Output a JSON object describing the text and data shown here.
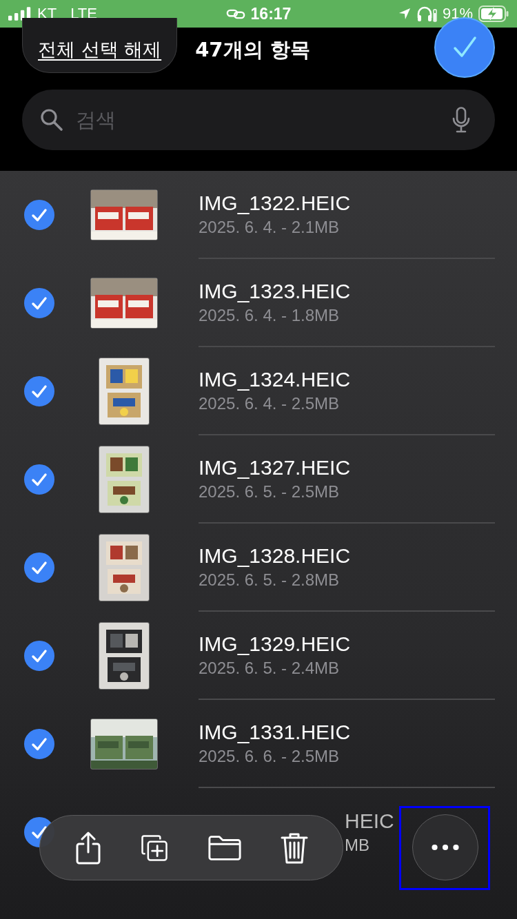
{
  "status_bar": {
    "carrier": "KT",
    "network": "LTE",
    "time": "16:17",
    "battery": "91%"
  },
  "header": {
    "deselect_button": "전체 선택 해제",
    "count": "47개의 항목",
    "done_selected": true
  },
  "search": {
    "placeholder": "검색"
  },
  "files": [
    {
      "name": "IMG_1322.HEIC",
      "meta": "2025. 6. 4. - 2.1MB",
      "checked": true,
      "partial": false
    },
    {
      "name": "IMG_1323.HEIC",
      "meta": "2025. 6. 4. - 1.8MB",
      "checked": true,
      "partial": false
    },
    {
      "name": "IMG_1324.HEIC",
      "meta": "2025. 6. 4. - 2.5MB",
      "checked": true,
      "partial": false
    },
    {
      "name": "IMG_1327.HEIC",
      "meta": "2025. 6. 5. - 2.5MB",
      "checked": true,
      "partial": false
    },
    {
      "name": "IMG_1328.HEIC",
      "meta": "2025. 6. 5. - 2.8MB",
      "checked": true,
      "partial": false
    },
    {
      "name": "IMG_1329.HEIC",
      "meta": "2025. 6. 5. - 2.4MB",
      "checked": true,
      "partial": false
    },
    {
      "name": "IMG_1331.HEIC",
      "meta": "2025. 6. 6. - 2.5MB",
      "checked": true,
      "partial": false
    },
    {
      "name": "HEIC",
      "meta": "MB",
      "checked": true,
      "partial": true
    }
  ],
  "toolbar": {
    "more_highlighted": true
  }
}
